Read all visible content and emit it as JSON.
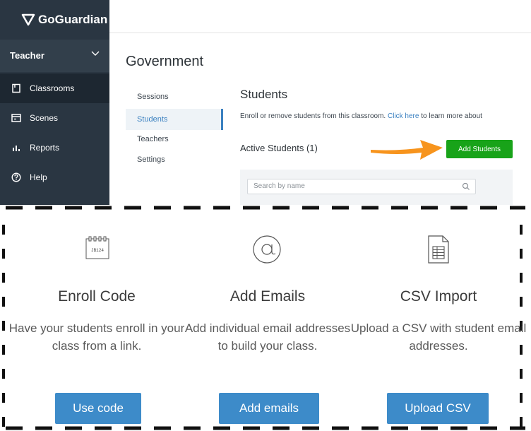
{
  "sidebar": {
    "logo": "GoGuardian",
    "role": "Teacher",
    "items": [
      {
        "label": "Classrooms",
        "icon": "classroom-icon"
      },
      {
        "label": "Scenes",
        "icon": "scenes-icon"
      },
      {
        "label": "Reports",
        "icon": "reports-icon"
      },
      {
        "label": "Help",
        "icon": "help-icon"
      }
    ]
  },
  "page": {
    "title": "Government"
  },
  "subnav": [
    "Sessions",
    "Students",
    "Teachers",
    "Settings"
  ],
  "students": {
    "title": "Students",
    "desc_before": "Enroll or remove students from this classroom. ",
    "desc_link": "Click here",
    "desc_after": " to learn more about",
    "active_label": "Active Students (1)",
    "add_button": "Add Students",
    "search_placeholder": "Search by name"
  },
  "options": [
    {
      "title": "Enroll Code",
      "desc": "Have your students enroll in your class from a link.",
      "button": "Use code",
      "icon_text": "JB124",
      "icon": "enroll-code-icon"
    },
    {
      "title": "Add Emails",
      "desc": "Add individual email addresses to build your class.",
      "button": "Add emails",
      "icon": "at-sign-icon"
    },
    {
      "title": "CSV Import",
      "desc": "Upload a CSV with student email addresses.",
      "button": "Upload CSV",
      "icon": "csv-file-icon"
    }
  ],
  "colors": {
    "sidebar": "#2a3642",
    "accent_blue": "#3d8bc9",
    "add_green": "#18a319",
    "arrow_orange": "#f7941d"
  }
}
